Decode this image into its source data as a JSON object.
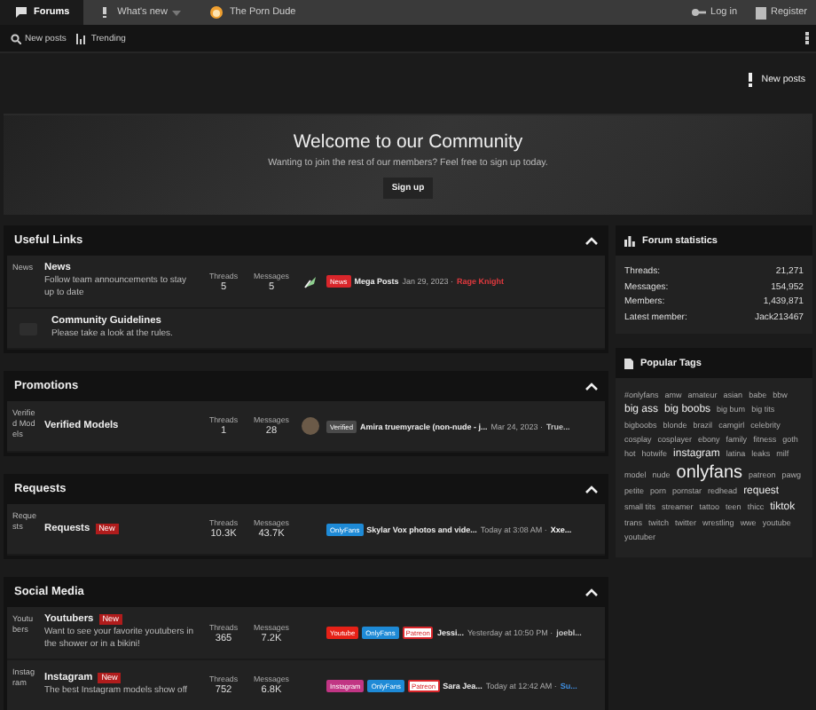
{
  "top_nav": {
    "tabs": [
      {
        "label": "Forums",
        "selected": true,
        "kind": "forums"
      },
      {
        "label": "What's new",
        "selected": false,
        "kind": "whatsnew"
      },
      {
        "label": "The Porn Dude",
        "selected": false,
        "kind": "logo"
      }
    ],
    "account": [
      "Log in",
      "Register"
    ]
  },
  "sub_nav": {
    "items": [
      "New posts",
      "Trending"
    ]
  },
  "new_posts_button": "New posts",
  "hero": {
    "title": "Welcome to our Community",
    "text": "Wanting to join the rest of our members? Feel free to sign up today.",
    "button": "Sign up"
  },
  "sections": [
    {
      "title": "Useful Links",
      "expanded": true,
      "forums": [
        {
          "kind": "forum",
          "icon_alt": "News",
          "name": "News",
          "description": "Follow team announcements to stay up to date",
          "threads_label": "Threads",
          "threads": "5",
          "messages_label": "Messages",
          "messages": "5",
          "avatar": {
            "kind": "icon"
          },
          "prefixes": [
            {
              "label": "News",
              "color": "#d9262b"
            }
          ],
          "title": "Mega Posts",
          "date": "Jan 29, 2023 ·",
          "user": {
            "name": "Rage Knight",
            "color": "#e0393e"
          }
        },
        {
          "kind": "link",
          "name": "Community Guidelines",
          "description": "Please take a look at the rules."
        }
      ]
    },
    {
      "title": "Promotions",
      "expanded": true,
      "forums": [
        {
          "kind": "forum",
          "icon_alt": "Verified Models",
          "name": "Verified Models",
          "threads_label": "Threads",
          "threads": "1",
          "messages_label": "Messages",
          "messages": "28",
          "avatar": {
            "kind": "photo"
          },
          "prefixes": [
            {
              "label": "Verified",
              "color": "#4a4a4a"
            }
          ],
          "title": "Amira truemyracle (non-nude - j...",
          "date": "Mar 24, 2023 ·",
          "user": {
            "name": "True...",
            "color": "#c8c8c8"
          }
        }
      ]
    },
    {
      "title": "Requests",
      "expanded": true,
      "forums": [
        {
          "kind": "forum",
          "icon_alt": "Requests",
          "name": "Requests",
          "badge": "New",
          "threads_label": "Threads",
          "threads": "10.3K",
          "messages_label": "Messages",
          "messages": "43.7K",
          "prefixes": [
            {
              "label": "OnlyFans",
              "color": "#1e8ad6"
            }
          ],
          "title": "Skylar Vox photos and vide...",
          "date": "Today at 3:08 AM ·",
          "user": {
            "name": "Xxe...",
            "color": "#ffffff"
          }
        }
      ]
    },
    {
      "title": "Social Media",
      "expanded": true,
      "forums": [
        {
          "kind": "forum",
          "icon_alt": "Youtubers",
          "name": "Youtubers",
          "badge": "New",
          "description": "Want to see your favorite youtubers in the shower or in a bikini!",
          "threads_label": "Threads",
          "threads": "365",
          "messages_label": "Messages",
          "messages": "7.2K",
          "prefixes": [
            {
              "label": "Youtube",
              "color": "#e62117"
            },
            {
              "label": "OnlyFans",
              "color": "#1e8ad6"
            },
            {
              "label": "Patreon",
              "color": "#ffffff"
            }
          ],
          "title": "Jessi...",
          "date": "Yesterday at 10:50 PM ·",
          "user": {
            "name": "joebl...",
            "color": "#c8c8c8"
          }
        },
        {
          "kind": "forum",
          "icon_alt": "Instagram",
          "name": "Instagram",
          "badge": "New",
          "description": "The best Instagram models show off",
          "threads_label": "Threads",
          "threads": "752",
          "messages_label": "Messages",
          "messages": "6.8K",
          "prefixes": [
            {
              "label": "Instagram",
              "color": "#c13584"
            },
            {
              "label": "OnlyFans",
              "color": "#1e8ad6"
            },
            {
              "label": "Patreon",
              "color": "#ffffff"
            }
          ],
          "title": "Sara Jea...",
          "date": "Today at 12:42 AM ·",
          "user": {
            "name": "Su...",
            "color": "#3f8ee0"
          }
        }
      ]
    }
  ],
  "forum_statistics": {
    "title": "Forum statistics",
    "rows": [
      {
        "label": "Threads:",
        "value": "21,271"
      },
      {
        "label": "Messages:",
        "value": "154,952"
      },
      {
        "label": "Members:",
        "value": "1,439,871"
      },
      {
        "label": "Latest member:",
        "value": "Jack213467"
      }
    ]
  },
  "popular_tags": {
    "title": "Popular Tags",
    "tags": [
      {
        "label": "#onlyfans",
        "kind": "small"
      },
      {
        "label": "amw",
        "kind": "small"
      },
      {
        "label": "amateur",
        "kind": "small"
      },
      {
        "label": "asian",
        "kind": "small"
      },
      {
        "label": "babe",
        "kind": "small"
      },
      {
        "label": "bbw",
        "kind": "small"
      },
      {
        "label": "big ass",
        "kind": "large"
      },
      {
        "label": "big boobs",
        "kind": "large"
      },
      {
        "label": "big bum",
        "kind": "small"
      },
      {
        "label": "big tits",
        "kind": "small"
      },
      {
        "label": "bigboobs",
        "kind": "small"
      },
      {
        "label": "blonde",
        "kind": "small"
      },
      {
        "label": "brazil",
        "kind": "small"
      },
      {
        "label": "camgirl",
        "kind": "small"
      },
      {
        "label": "celebrity",
        "kind": "small"
      },
      {
        "label": "cosplay",
        "kind": "small"
      },
      {
        "label": "cosplayer",
        "kind": "small"
      },
      {
        "label": "ebony",
        "kind": "small"
      },
      {
        "label": "family",
        "kind": "small"
      },
      {
        "label": "fitness",
        "kind": "small"
      },
      {
        "label": "goth",
        "kind": "small"
      },
      {
        "label": "hot",
        "kind": "small"
      },
      {
        "label": "hotwife",
        "kind": "small"
      },
      {
        "label": "instagram",
        "kind": "large"
      },
      {
        "label": "latina",
        "kind": "small"
      },
      {
        "label": "leaks",
        "kind": "small"
      },
      {
        "label": "milf",
        "kind": "small"
      },
      {
        "label": "model",
        "kind": "small"
      },
      {
        "label": "nude",
        "kind": "small"
      },
      {
        "label": "onlyfans",
        "kind": "huge"
      },
      {
        "label": "patreon",
        "kind": "small"
      },
      {
        "label": "pawg",
        "kind": "small"
      },
      {
        "label": "petite",
        "kind": "small"
      },
      {
        "label": "porn",
        "kind": "small"
      },
      {
        "label": "pornstar",
        "kind": "small"
      },
      {
        "label": "redhead",
        "kind": "small"
      },
      {
        "label": "request",
        "kind": "large"
      },
      {
        "label": "small tits",
        "kind": "small"
      },
      {
        "label": "streamer",
        "kind": "small"
      },
      {
        "label": "tattoo",
        "kind": "small"
      },
      {
        "label": "teen",
        "kind": "small"
      },
      {
        "label": "thicc",
        "kind": "small"
      },
      {
        "label": "tiktok",
        "kind": "large"
      },
      {
        "label": "trans",
        "kind": "small"
      },
      {
        "label": "twitch",
        "kind": "small"
      },
      {
        "label": "twitter",
        "kind": "small"
      },
      {
        "label": "wrestling",
        "kind": "small"
      },
      {
        "label": "wwe",
        "kind": "small"
      },
      {
        "label": "youtube",
        "kind": "small"
      },
      {
        "label": "youtuber",
        "kind": "small"
      }
    ]
  }
}
